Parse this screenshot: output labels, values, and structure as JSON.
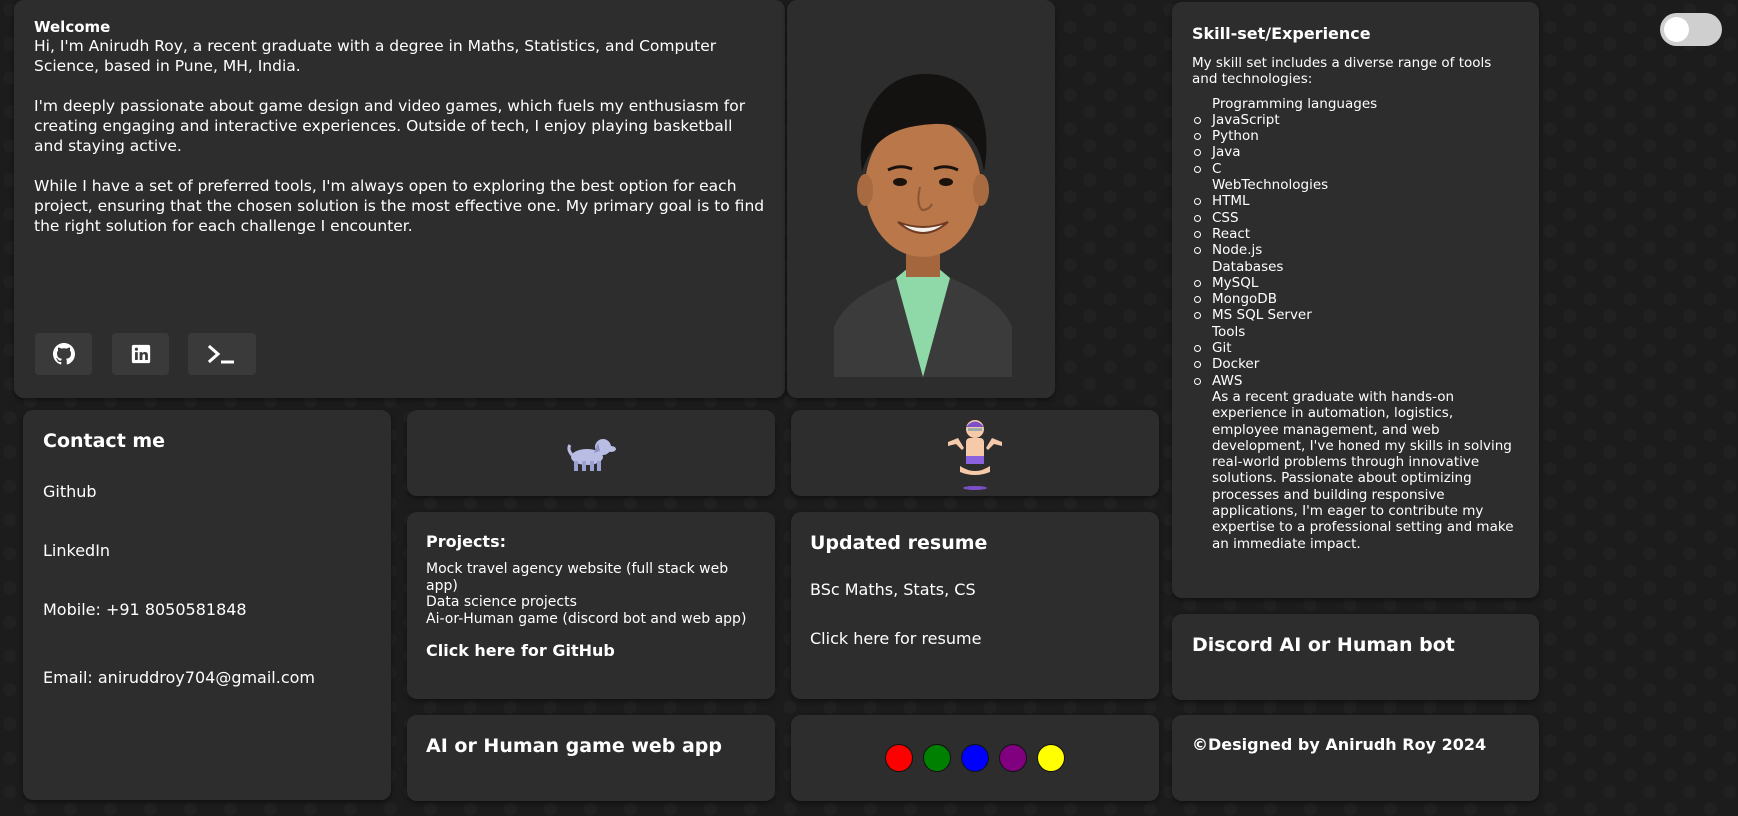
{
  "welcome": {
    "title": "Welcome",
    "para1": "Hi, I'm Anirudh Roy, a recent graduate with a degree in Maths, Statistics, and Computer Science, based in Pune, MH, India.",
    "para2": "I'm deeply passionate about game design and video games, which fuels my enthusiasm for creating engaging and interactive experiences. Outside of tech, I enjoy playing basketball and staying active.",
    "para3": "While I have a set of preferred tools, I'm always open to exploring the best option for each project, ensuring that the chosen solution is the most effective one. My primary goal is to find the right solution for each challenge I encounter.",
    "social": [
      "github-icon",
      "linkedin-icon",
      "terminal-icon"
    ]
  },
  "skills": {
    "title": "Skill-set/Experience",
    "intro": "My skill set includes a diverse range of tools and technologies:",
    "categories": [
      {
        "name": "Programming languages",
        "items": [
          "JavaScript",
          "Python",
          "Java",
          "C"
        ]
      },
      {
        "name": "WebTechnologies",
        "items": [
          "HTML",
          "CSS",
          "React",
          "Node.js"
        ]
      },
      {
        "name": "Databases",
        "items": [
          "MySQL",
          "MongoDB",
          "MS SQL Server"
        ]
      },
      {
        "name": "Tools",
        "items": [
          "Git",
          "Docker",
          "AWS"
        ]
      }
    ],
    "summary": "As a recent graduate with hands-on experience in automation, logistics, employee management, and web development, I've honed my skills in solving real-world problems through innovative solutions. Passionate about optimizing processes and building responsive applications, I'm eager to contribute my expertise to a professional setting and make an immediate impact."
  },
  "contact": {
    "title": "Contact me",
    "github": "Github",
    "linkedin": "LinkedIn",
    "mobile": "Mobile: +91 8050581848",
    "email": "Email: aniruddroy704@gmail.com"
  },
  "projects": {
    "title": "Projects:",
    "items": [
      "Mock travel agency website (full stack web app)",
      "Data science projects",
      "Ai-or-Human game (discord bot and web app)"
    ],
    "link": "Click here for GitHub"
  },
  "resume": {
    "title": "Updated resume",
    "degree": "BSc Maths, Stats, CS",
    "link": "Click here for resume"
  },
  "discord": {
    "title": "Discord AI or Human bot"
  },
  "ai_game": {
    "title": "AI or Human game web app"
  },
  "theme_colors": [
    "#ff0000",
    "#008000",
    "#0000ff",
    "#800080",
    "#ffff00"
  ],
  "footer": {
    "text": "©Designed by Anirudh Roy 2024"
  },
  "colors": {
    "background": "#1c1c1c",
    "card": "#2d2d2d",
    "button": "#3a3a3a",
    "text": "#ffffff"
  }
}
